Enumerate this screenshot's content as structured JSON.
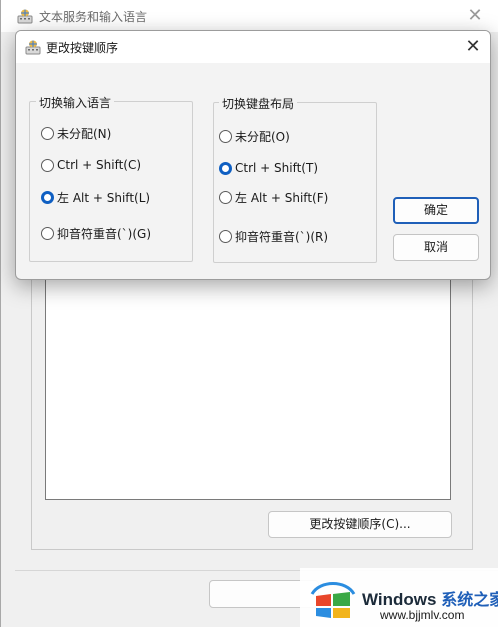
{
  "bg_window": {
    "title": "文本服务和输入语言",
    "change_key_button": "更改按键顺序(C)..."
  },
  "dialog": {
    "title": "更改按键顺序",
    "input_language_group": {
      "title": "切换输入语言",
      "options": [
        {
          "label": "未分配(N)",
          "checked": false
        },
        {
          "label": "Ctrl + Shift(C)",
          "checked": false
        },
        {
          "label": "左 Alt + Shift(L)",
          "checked": true
        },
        {
          "label": "抑音符重音(`)(G)",
          "checked": false
        }
      ]
    },
    "keyboard_layout_group": {
      "title": "切换键盘布局",
      "options": [
        {
          "label": "未分配(O)",
          "checked": false
        },
        {
          "label": "Ctrl + Shift(T)",
          "checked": true
        },
        {
          "label": "左 Alt + Shift(F)",
          "checked": false
        },
        {
          "label": "抑音符重音(`)(R)",
          "checked": false
        }
      ]
    },
    "ok_button": "确定",
    "cancel_button": "取消"
  },
  "watermark": {
    "brand": "Windows",
    "brand_cn": "系统之家",
    "url": "www.bjjmlv.com"
  },
  "colors": {
    "accent": "#0f5fc2",
    "dialog_bg": "#f3f3f3"
  }
}
